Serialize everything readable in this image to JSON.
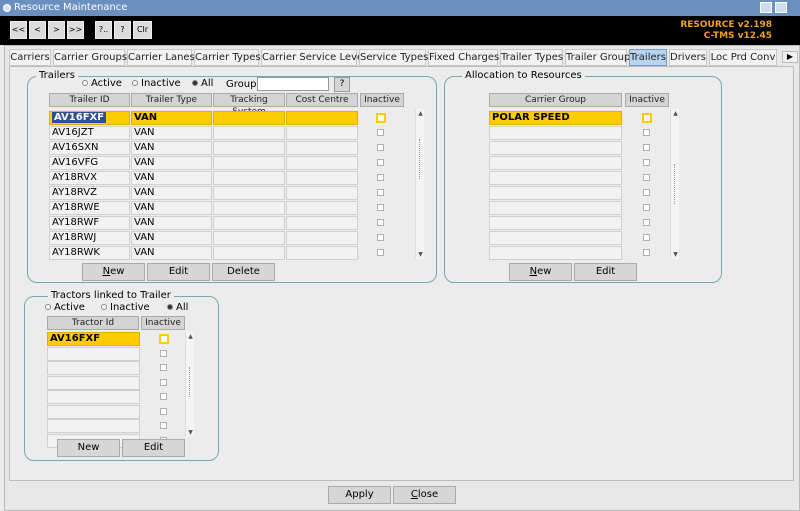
{
  "window": {
    "title": "Resource Maintenance"
  },
  "nav": [
    "<<",
    "<",
    ">",
    ">>",
    "?..",
    "?",
    "Clr"
  ],
  "version": {
    "resource": "RESOURCE v2.198",
    "ctms": "C-TMS v12.45"
  },
  "tabs": [
    "Carriers",
    "Carrier Groups",
    "Carrier Lanes",
    "Carrier Types",
    "Carrier Service Level",
    "Service Types",
    "Fixed Charges",
    "Trailer Types",
    "Trailer Group",
    "Trailers",
    "Drivers",
    "Loc Prd Conv"
  ],
  "active_tab": "Trailers",
  "trailers": {
    "title": "Trailers",
    "filters": {
      "active": "Active",
      "inactive": "Inactive",
      "all": "All",
      "selected": "All"
    },
    "group_label": "Group",
    "group_value": "",
    "group_btn": "?",
    "columns": [
      "Trailer ID",
      "Trailer Type",
      "Tracking System",
      "Cost Centre",
      "Inactive"
    ],
    "rows": [
      {
        "id": "AV16FXF",
        "type": "VAN"
      },
      {
        "id": "AV16JZT",
        "type": "VAN"
      },
      {
        "id": "AV16SXN",
        "type": "VAN"
      },
      {
        "id": "AV16VFG",
        "type": "VAN"
      },
      {
        "id": "AY18RVX",
        "type": "VAN"
      },
      {
        "id": "AY18RVZ",
        "type": "VAN"
      },
      {
        "id": "AY18RWE",
        "type": "VAN"
      },
      {
        "id": "AY18RWF",
        "type": "VAN"
      },
      {
        "id": "AY18RWJ",
        "type": "VAN"
      },
      {
        "id": "AY18RWK",
        "type": "VAN"
      }
    ],
    "buttons": {
      "new_pre": "",
      "new_u": "N",
      "new_post": "ew",
      "edit": "Edit",
      "delete": "Delete"
    }
  },
  "allocation": {
    "title": "Allocation to Resources",
    "columns": [
      "Carrier Group",
      "Inactive"
    ],
    "rows": [
      "POLAR SPEED",
      "",
      "",
      "",
      "",
      "",
      "",
      "",
      "",
      ""
    ],
    "buttons": {
      "new_pre": "",
      "new_u": "N",
      "new_post": "ew",
      "edit": "Edit"
    }
  },
  "tractors": {
    "title": "Tractors linked to Trailer",
    "filters": {
      "active": "Active",
      "inactive": "Inactive",
      "all": "All",
      "selected": "All"
    },
    "columns": [
      "Tractor Id",
      "Inactive"
    ],
    "rows": [
      "AV16FXF",
      "",
      "",
      "",
      "",
      "",
      "",
      ""
    ],
    "buttons": {
      "new": "New",
      "edit": "Edit"
    }
  },
  "footer": {
    "apply": "Apply",
    "close_pre": "",
    "close_u": "C",
    "close_post": "lose"
  }
}
